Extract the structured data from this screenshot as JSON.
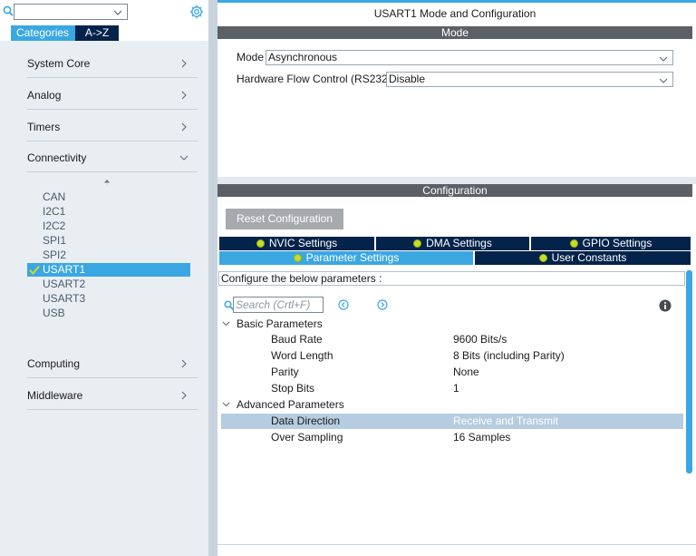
{
  "window": {
    "title": "USART1 Mode and Configuration"
  },
  "left_panel": {
    "search": {
      "value": ""
    },
    "tabs": {
      "categories": "Categories",
      "atoz": "A->Z"
    },
    "categories": [
      {
        "label": "System Core",
        "state": "collapsed"
      },
      {
        "label": "Analog",
        "state": "collapsed"
      },
      {
        "label": "Timers",
        "state": "collapsed"
      },
      {
        "label": "Connectivity",
        "state": "expanded"
      },
      {
        "label": "Computing",
        "state": "collapsed"
      },
      {
        "label": "Middleware",
        "state": "collapsed"
      }
    ],
    "peripherals": [
      "CAN",
      "I2C1",
      "I2C2",
      "SPI1",
      "SPI2",
      "USART1",
      "USART2",
      "USART3",
      "USB"
    ],
    "selected_peripheral": "USART1"
  },
  "mode": {
    "section_title": "Mode",
    "mode_label": "Mode",
    "mode_value": "Asynchronous",
    "flow_label": "Hardware Flow Control (RS232)",
    "flow_value": "Disable"
  },
  "configuration": {
    "section_title": "Configuration",
    "reset_label": "Reset Configuration",
    "tabs": {
      "nvic": "NVIC Settings",
      "dma": "DMA Settings",
      "gpio": "GPIO Settings",
      "params": "Parameter Settings",
      "user_constants": "User Constants"
    },
    "hint": "Configure the below parameters :",
    "search_placeholder": "Search (Crtl+F)",
    "groups": [
      {
        "title": "Basic Parameters",
        "rows": [
          {
            "name": "Baud Rate",
            "value": "9600 Bits/s"
          },
          {
            "name": "Word Length",
            "value": "8 Bits (including Parity)"
          },
          {
            "name": "Parity",
            "value": "None"
          },
          {
            "name": "Stop Bits",
            "value": "1"
          }
        ]
      },
      {
        "title": "Advanced Parameters",
        "rows": [
          {
            "name": "Data Direction",
            "value": "Receive and Transmit",
            "selected": true
          },
          {
            "name": "Over Sampling",
            "value": "16 Samples"
          }
        ]
      }
    ]
  },
  "colors": {
    "accent": "#3aa7e3",
    "navy": "#03234b",
    "section_bar": "#5b6067",
    "status_ok": "#c7dc2c",
    "selection": "#b6cce0"
  }
}
